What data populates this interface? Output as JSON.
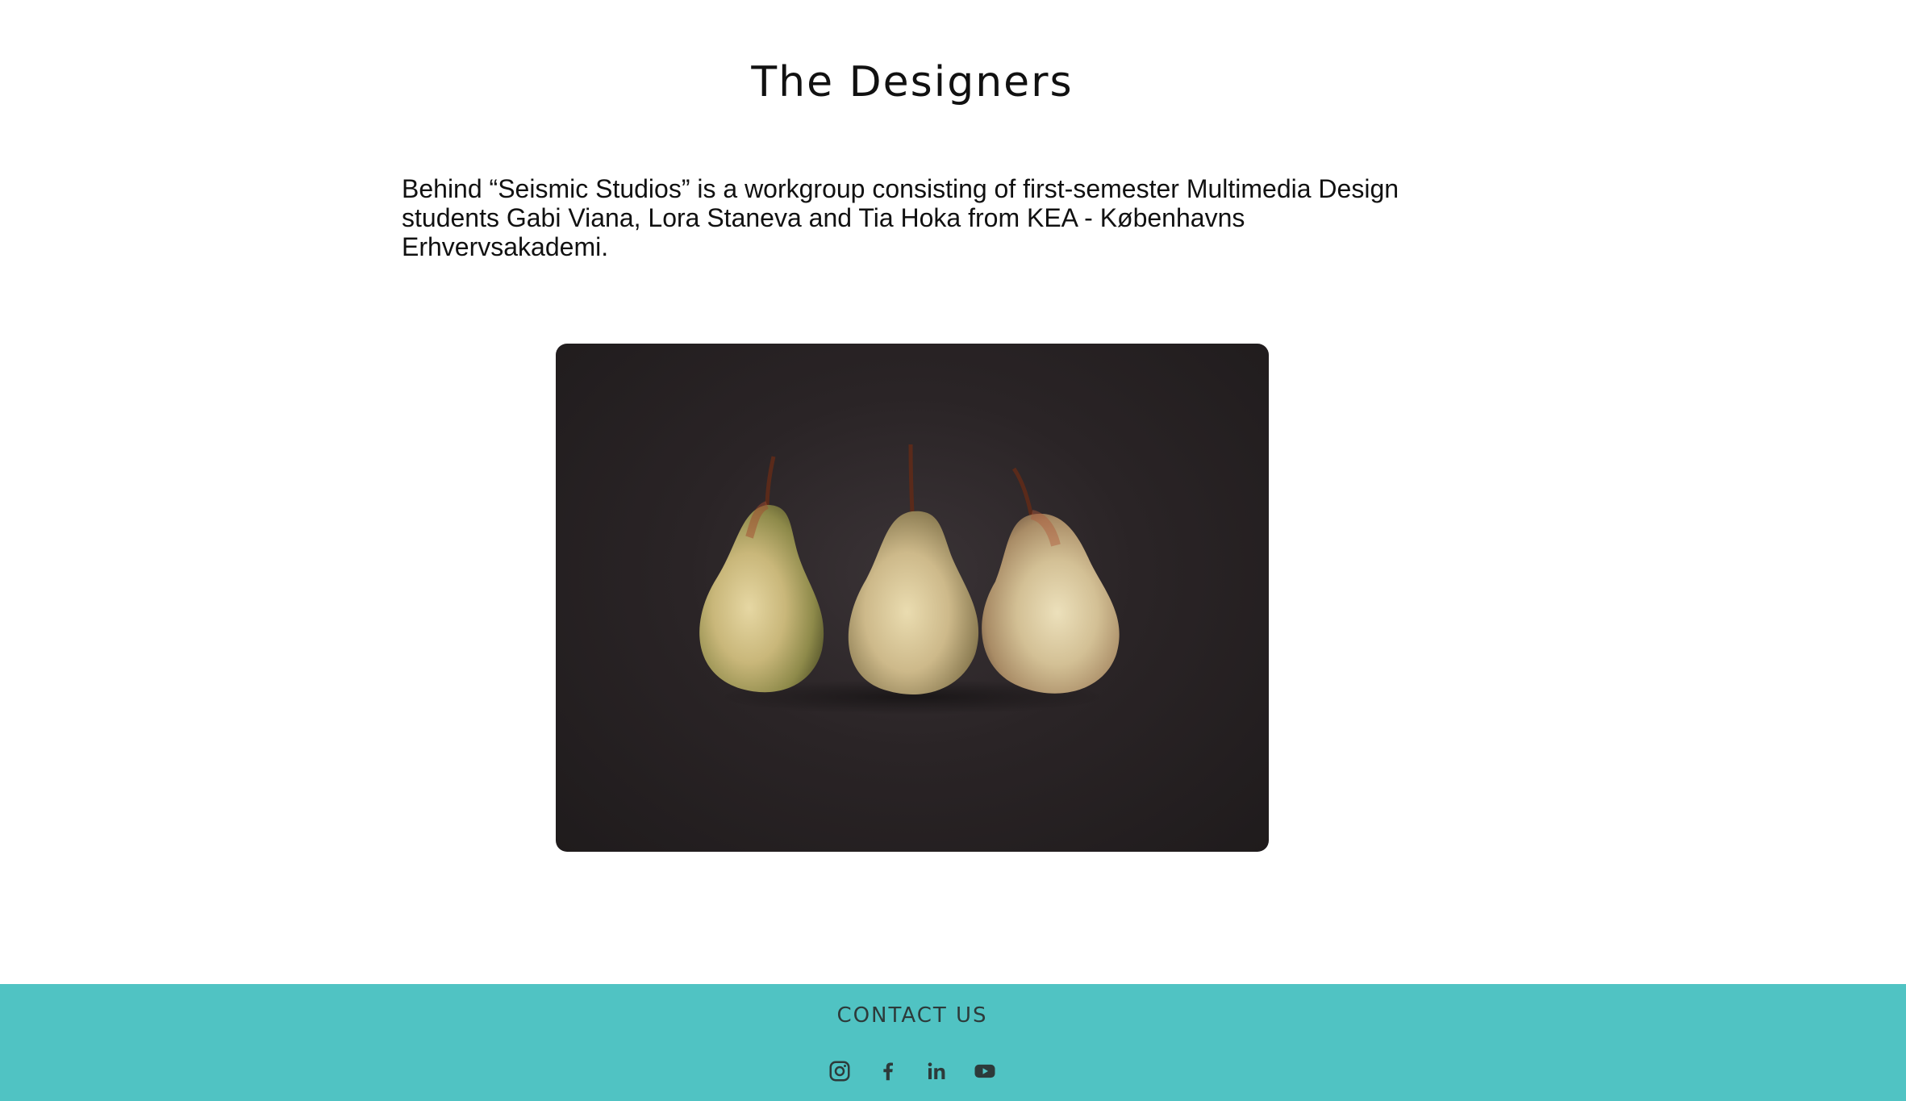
{
  "main": {
    "title": "The Designers",
    "intro": "Behind “Seismic Studios” is a workgroup consisting of first-semester Multimedia Design students Gabi Viana, Lora Staneva and Tia Hoka from KEA - Københavns Erhvervsakademi."
  },
  "image": {
    "subject": "three-pears-photo"
  },
  "footer": {
    "title": "CONTACT US",
    "social": [
      {
        "icon": "instagram-icon"
      },
      {
        "icon": "facebook-icon"
      },
      {
        "icon": "linkedin-icon"
      },
      {
        "icon": "youtube-icon"
      }
    ]
  },
  "colors": {
    "footer_bg": "#50c3c3",
    "icon": "#2d3a3a",
    "text": "#111111"
  }
}
